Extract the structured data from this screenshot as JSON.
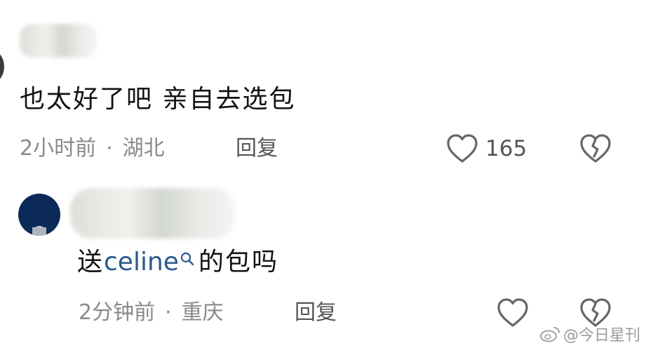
{
  "comments": [
    {
      "text": "也太好了吧 亲自去选包",
      "time": "2小时前",
      "separator": "·",
      "location": "湖北",
      "reply_label": "回复",
      "likes": "165"
    },
    {
      "text_before": "送",
      "link_text": "celine",
      "text_after": "的包吗",
      "time": "2分钟前",
      "separator": "·",
      "location": "重庆",
      "reply_label": "回复"
    }
  ],
  "watermark": "@今日星刊",
  "icons": [
    "heart-outline-icon",
    "broken-heart-icon",
    "search-icon",
    "weibo-logo-icon"
  ]
}
